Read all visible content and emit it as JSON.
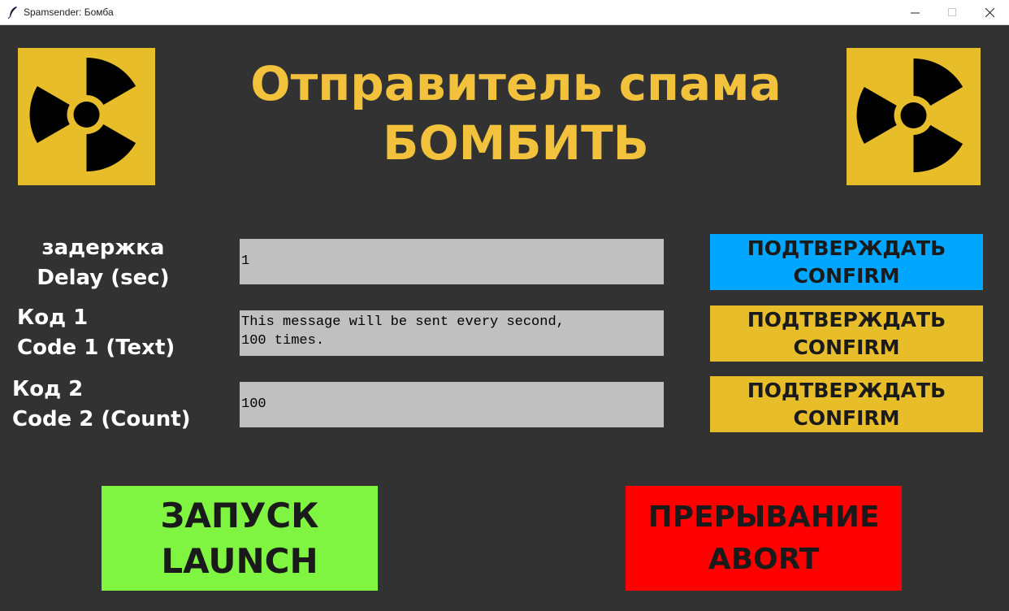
{
  "window": {
    "title": "Spamsender: Бомба",
    "icon": "feather-icon"
  },
  "header": {
    "line1": "Отправитель спама",
    "line2": "БОМБИТЬ",
    "color": "#f2c23c",
    "logo_icon": "radiation-icon"
  },
  "fields": {
    "delay": {
      "label_line1": "задержка",
      "label_line2": "Delay (sec)",
      "value": "1",
      "confirm_line1": "ПОДТВЕРЖДАТЬ",
      "confirm_line2": "CONFIRM",
      "confirm_color": "#00a6ff"
    },
    "code1": {
      "label_line1": "Код 1",
      "label_line2": "Code 1 (Text)",
      "value": "This message will be sent every second,\n100 times.",
      "confirm_line1": "ПОДТВЕРЖДАТЬ",
      "confirm_line2": "CONFIRM",
      "confirm_color": "#e8bd2a"
    },
    "code2": {
      "label_line1": "Код 2",
      "label_line2": "Code 2 (Count)",
      "value": "100",
      "confirm_line1": "ПОДТВЕРЖДАТЬ",
      "confirm_line2": "CONFIRM",
      "confirm_color": "#e8bd2a"
    }
  },
  "actions": {
    "launch": {
      "line1": "ЗАПУСК",
      "line2": "LAUNCH",
      "color": "#7ff542"
    },
    "abort": {
      "line1": "ПРЕРЫВАНИЕ",
      "line2": "ABORT",
      "color": "#ff0000"
    }
  },
  "colors": {
    "background": "#333232",
    "input_bg": "#c0c0c0",
    "label_text": "#ffffff"
  }
}
